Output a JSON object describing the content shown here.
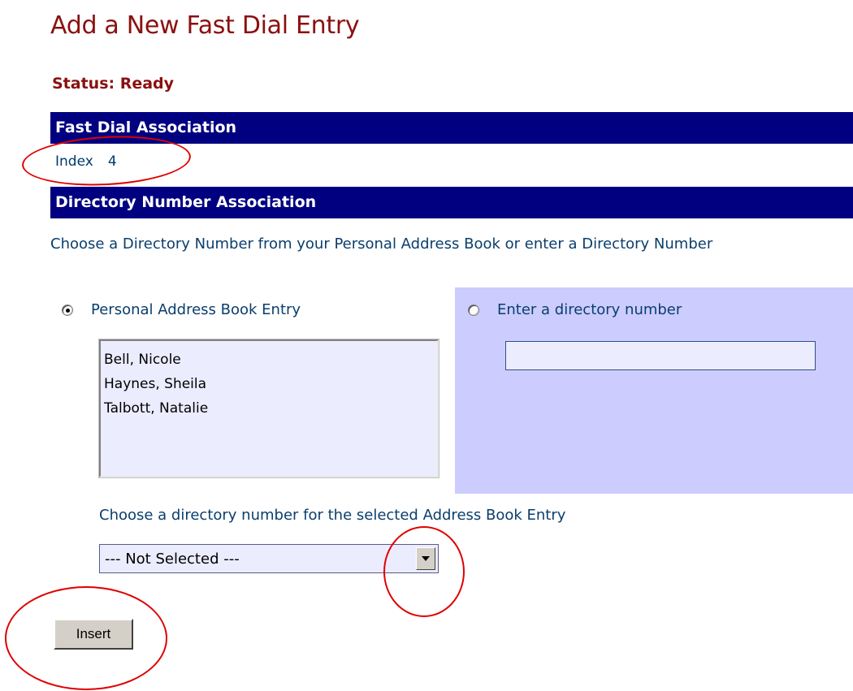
{
  "page": {
    "title": "Add a New Fast Dial Entry",
    "status": "Status: Ready"
  },
  "fast_dial_association": {
    "header": "Fast Dial Association",
    "index_label": "Index",
    "index_value": "4"
  },
  "directory_number_association": {
    "header": "Directory Number Association",
    "instructions": "Choose a Directory Number from your Personal Address Book or enter a Directory Number",
    "option_address_book": {
      "label": "Personal Address Book Entry",
      "checked": true
    },
    "option_enter_number": {
      "label": "Enter a directory number",
      "checked": false,
      "input_value": ""
    },
    "address_book_entries": [
      "Bell, Nicole",
      "Haynes, Sheila",
      "Talbott, Natalie"
    ],
    "choose_number_label": "Choose a directory number for the selected Address Book Entry",
    "number_select_value": "--- Not Selected ---"
  },
  "actions": {
    "insert_label": "Insert"
  },
  "colors": {
    "title": "#8b1010",
    "header_bar": "#000080",
    "panel": "#ccccff",
    "annotation": "#e00000"
  }
}
